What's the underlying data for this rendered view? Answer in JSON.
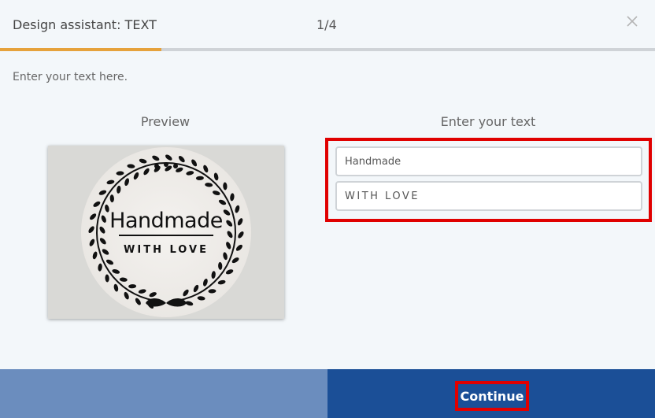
{
  "header": {
    "title": "Design assistant: TEXT",
    "step": "1/4",
    "progress_fraction": 0.25
  },
  "instruction": "Enter your text here.",
  "preview": {
    "title": "Preview",
    "label_line1": "Handmade",
    "label_line2": "WITH LOVE"
  },
  "text_entry": {
    "title": "Enter your text",
    "fields": [
      {
        "value": "Handmade"
      },
      {
        "value": "WITH LOVE"
      }
    ]
  },
  "footer": {
    "continue_label": "Continue"
  },
  "colors": {
    "accent": "#e6a23c",
    "footer_dark": "#1b4f97",
    "footer_light": "#6b8dbe",
    "highlight": "#e00000"
  },
  "icons": {
    "close": "close-icon"
  }
}
